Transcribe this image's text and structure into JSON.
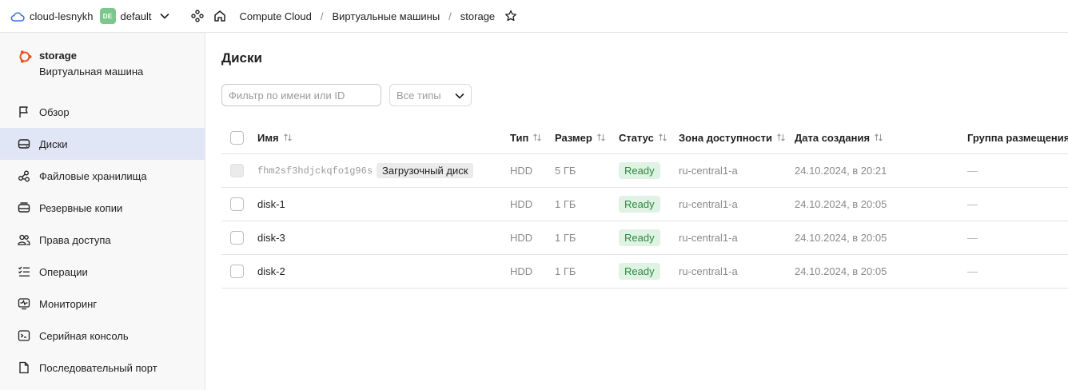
{
  "topbar": {
    "cloud_name": "cloud-lesnykh",
    "folder_badge": "DE",
    "folder_name": "default",
    "breadcrumbs": [
      "Compute Cloud",
      "Виртуальные машины"
    ],
    "separator": "/",
    "current": "storage"
  },
  "sidebar": {
    "vm_name": "storage",
    "vm_type": "Виртуальная машина",
    "items": [
      {
        "label": "Обзор",
        "icon": "flag-icon"
      },
      {
        "label": "Диски",
        "icon": "disk-icon",
        "active": true
      },
      {
        "label": "Файловые хранилища",
        "icon": "share-nodes-icon"
      },
      {
        "label": "Резервные копии",
        "icon": "backup-icon"
      },
      {
        "label": "Права доступа",
        "icon": "persons-icon"
      },
      {
        "label": "Операции",
        "icon": "list-check-icon"
      },
      {
        "label": "Мониторинг",
        "icon": "monitor-icon"
      },
      {
        "label": "Серийная консоль",
        "icon": "terminal-icon"
      },
      {
        "label": "Последовательный порт",
        "icon": "file-icon"
      }
    ]
  },
  "main": {
    "title": "Диски",
    "filter_placeholder": "Фильтр по имени или ID",
    "type_select": "Все типы",
    "columns": {
      "name": "Имя",
      "type": "Тип",
      "size": "Размер",
      "status": "Статус",
      "zone": "Зона доступности",
      "created": "Дата создания",
      "placement": "Группа размещения"
    },
    "rows": [
      {
        "name": "fhm2sf3hdjckqfo1g96s",
        "boot_label": "Загрузочный диск",
        "type": "HDD",
        "size": "5 ГБ",
        "status": "Ready",
        "zone": "ru-central1-a",
        "created": "24.10.2024, в 20:21",
        "placement": "—"
      },
      {
        "name": "disk-1",
        "type": "HDD",
        "size": "1 ГБ",
        "status": "Ready",
        "zone": "ru-central1-a",
        "created": "24.10.2024, в 20:05",
        "placement": "—"
      },
      {
        "name": "disk-3",
        "type": "HDD",
        "size": "1 ГБ",
        "status": "Ready",
        "zone": "ru-central1-a",
        "created": "24.10.2024, в 20:05",
        "placement": "—"
      },
      {
        "name": "disk-2",
        "type": "HDD",
        "size": "1 ГБ",
        "status": "Ready",
        "zone": "ru-central1-a",
        "created": "24.10.2024, в 20:05",
        "placement": "—"
      }
    ]
  },
  "colors": {
    "accent": "#3b6de3",
    "active_nav_bg": "#e1e6f7",
    "status_bg": "#dff2e3",
    "status_text": "#2a8a3f",
    "folder_badge": "#7cc78c",
    "ubuntu_orange": "#e95420"
  }
}
